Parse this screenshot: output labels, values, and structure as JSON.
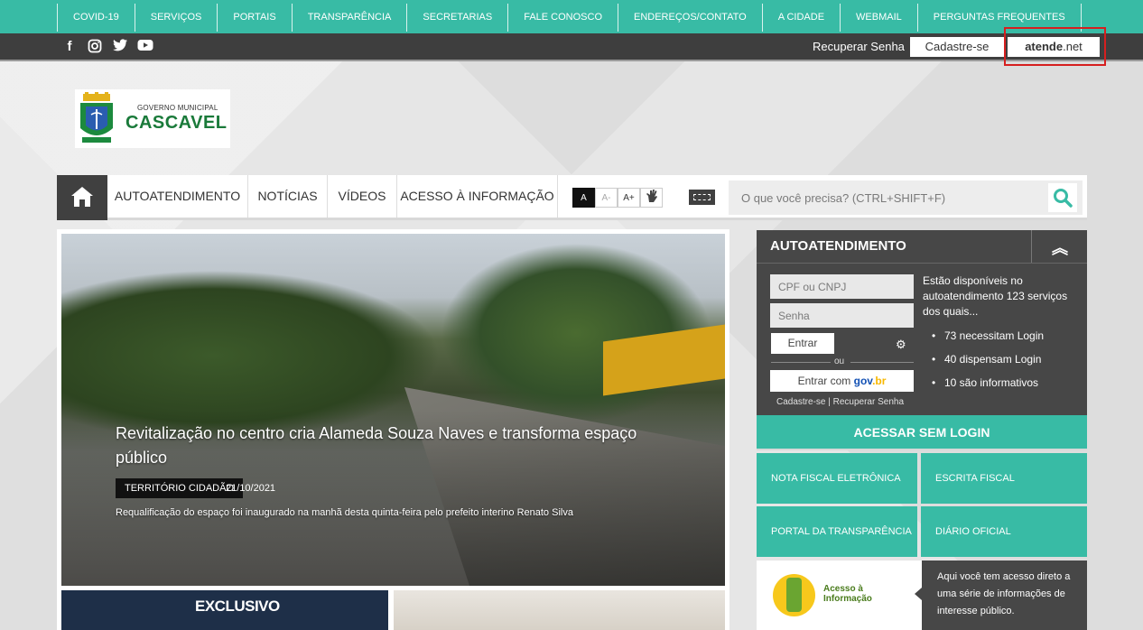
{
  "topnav": {
    "items": [
      "COVID-19",
      "SERVIÇOS",
      "PORTAIS",
      "TRANSPARÊNCIA",
      "SECRETARIAS",
      "FALE CONOSCO",
      "ENDEREÇOS/CONTATO",
      "A CIDADE",
      "WEBMAIL",
      "PERGUNTAS FREQUENTES"
    ]
  },
  "userbar": {
    "recover": "Recuperar Senha",
    "signup": "Cadastre-se",
    "atende_bold": "atende",
    "atende_rest": ".net"
  },
  "logo": {
    "line1": "GOVERNO MUNICIPAL",
    "line2": "CASCAVEL"
  },
  "menu": {
    "items": [
      "AUTOATENDIMENTO",
      "NOTÍCIAS",
      "VÍDEOS",
      "ACESSO À INFORMAÇÃO"
    ],
    "font_normal": "A",
    "font_decrease": "A-",
    "font_increase": "A+",
    "search_placeholder": "O que você precisa? (CTRL+SHIFT+F)"
  },
  "feature": {
    "headline": "Revitalização no centro cria Alameda Souza Naves e transforma espaço público",
    "tag": "TERRITÓRIO CIDADÃO",
    "date": "21/10/2021",
    "summary": "Requalificação do espaço foi inaugurado na manhã desta quinta-feira pelo prefeito interino Renato Silva"
  },
  "thumbs": {
    "first_text": "EXCLUSIVO"
  },
  "autoatendimento": {
    "title": "AUTOATENDIMENTO",
    "cpf_placeholder": "CPF ou CNPJ",
    "password_placeholder": "Senha",
    "enter": "Entrar",
    "or": "ou",
    "govbr_prefix": "Entrar com",
    "govbr_g": "gov",
    "govbr_b": ".br",
    "signup": "Cadastre-se",
    "recover": "Recuperar Senha",
    "info": "Estão disponíveis no autoatendimento 123 serviços dos quais...",
    "stats": [
      "73 necessitam Login",
      "40 dispensam Login",
      "10 são informativos"
    ]
  },
  "quicklinks": {
    "no_login": "ACESSAR SEM LOGIN",
    "tiles": [
      "NOTA FISCAL ELETRÔNICA",
      "ESCRITA FISCAL",
      "PORTAL DA TRANSPARÊNCIA",
      "DIÁRIO OFICIAL"
    ]
  },
  "acesso_info": {
    "logo_text_1": "Acesso à",
    "logo_text_2": "Informação",
    "description": "Aqui você tem acesso direto a uma série de informações de interesse público."
  },
  "colors": {
    "accent": "#38bba5",
    "dark": "#404040",
    "highlight": "#d61f1f"
  }
}
